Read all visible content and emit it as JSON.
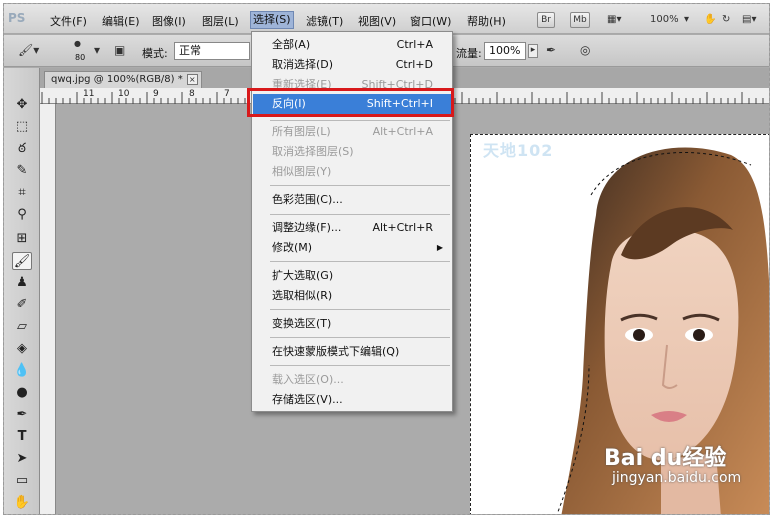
{
  "menubar": {
    "logo": "PS",
    "items": [
      "文件(F)",
      "编辑(E)",
      "图像(I)",
      "图层(L)",
      "选择(S)",
      "滤镜(T)",
      "视图(V)",
      "窗口(W)",
      "帮助(H)"
    ],
    "active_index": 4,
    "buttons": [
      "Br",
      "Mb"
    ],
    "zoom": "100%"
  },
  "optionsbar": {
    "brush_size": "80",
    "mode_label": "模式:",
    "mode_value": "正常",
    "flow_label": "流量:",
    "flow_value": "100%"
  },
  "document": {
    "tab_title": "qwq.jpg @ 100%(RGB/8) *",
    "close_glyph": "×",
    "ruler_numbers": [
      "11",
      "10",
      "9",
      "8",
      "7"
    ]
  },
  "photo": {
    "watermark": "天地102",
    "baidu_logo": "Bai du经验",
    "baidu_url": "jingyan.baidu.com"
  },
  "dropdown": {
    "items": [
      {
        "label": "全部(A)",
        "shortcut": "Ctrl+A",
        "disabled": false
      },
      {
        "label": "取消选择(D)",
        "shortcut": "Ctrl+D",
        "disabled": false
      },
      {
        "label": "重新选择(E)",
        "shortcut": "Shift+Ctrl+D",
        "disabled": true
      },
      {
        "label": "反向(I)",
        "shortcut": "Shift+Ctrl+I",
        "disabled": false,
        "highlighted": true
      },
      {
        "label": "所有图层(L)",
        "shortcut": "Alt+Ctrl+A",
        "disabled": true
      },
      {
        "label": "取消选择图层(S)",
        "shortcut": "",
        "disabled": true
      },
      {
        "label": "相似图层(Y)",
        "shortcut": "",
        "disabled": true
      },
      {
        "label": "色彩范围(C)...",
        "shortcut": "",
        "disabled": false
      },
      {
        "label": "调整边缘(F)...",
        "shortcut": "Alt+Ctrl+R",
        "disabled": false
      },
      {
        "label": "修改(M)",
        "shortcut": "",
        "disabled": false,
        "submenu": true
      },
      {
        "label": "扩大选取(G)",
        "shortcut": "",
        "disabled": false
      },
      {
        "label": "选取相似(R)",
        "shortcut": "",
        "disabled": false
      },
      {
        "label": "变换选区(T)",
        "shortcut": "",
        "disabled": false
      },
      {
        "label": "在快速蒙版模式下编辑(Q)",
        "shortcut": "",
        "disabled": false
      },
      {
        "label": "载入选区(O)...",
        "shortcut": "",
        "disabled": true
      },
      {
        "label": "存储选区(V)...",
        "shortcut": "",
        "disabled": false
      }
    ]
  },
  "colors": {
    "highlight": "#3a7fd8",
    "annotation": "#d8191b"
  }
}
